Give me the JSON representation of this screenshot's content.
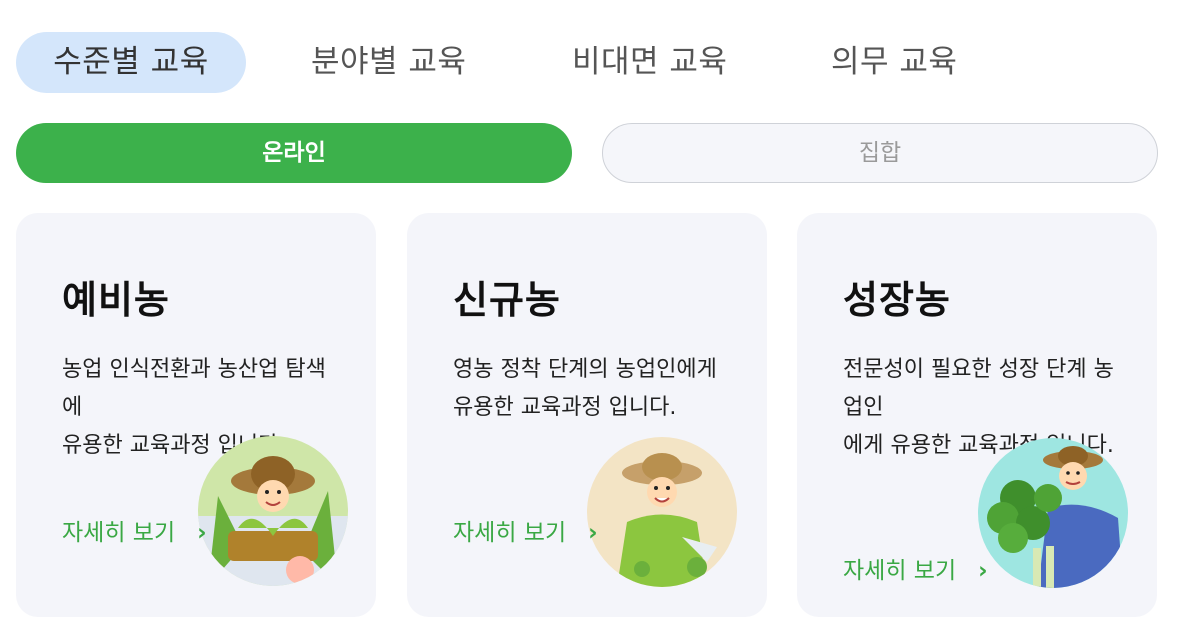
{
  "tabs": [
    {
      "label": "수준별 교육",
      "active": true
    },
    {
      "label": "분야별 교육",
      "active": false
    },
    {
      "label": "비대면 교육",
      "active": false
    },
    {
      "label": "의무 교육",
      "active": false
    }
  ],
  "toggle": {
    "online_label": "온라인",
    "group_label": "집합",
    "selected": "온라인"
  },
  "cards": [
    {
      "title": "예비농",
      "desc": "농업 인식전환과 농산업 탐색에\n유용한 교육과정 입니다.",
      "link": "자세히 보기",
      "chevron": "›"
    },
    {
      "title": "신규농",
      "desc": "영농 정착 단계의 농업인에게\n유용한 교육과정 입니다.",
      "link": "자세히 보기",
      "chevron": "›"
    },
    {
      "title": "성장농",
      "desc": "전문성이 필요한 성장 단계 농업인\n에게 유용한 교육과정 입니다.",
      "link": "자세히 보기",
      "chevron": "›"
    }
  ],
  "colors": {
    "accent_green": "#3cb14b",
    "link_green": "#3aa844",
    "active_tab_bg": "#d4e6fb",
    "card_bg": "#f4f5fa"
  },
  "icons": [
    "chevron-right-icon",
    "farmer-illustration-icon"
  ]
}
